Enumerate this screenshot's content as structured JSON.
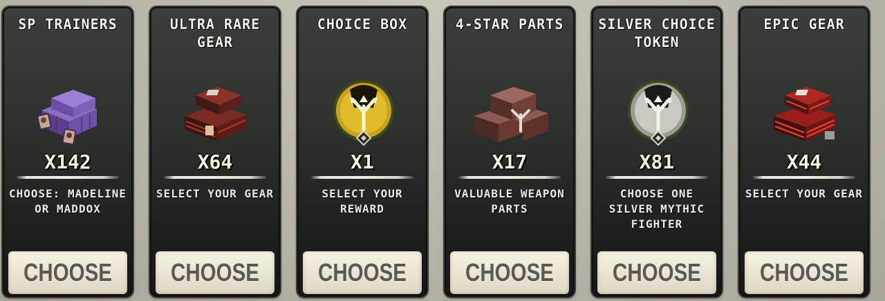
{
  "offers": [
    {
      "title": "SP TRAINERS",
      "art": "purple-crates-icon",
      "quantity": "X142",
      "description": "CHOOSE: MADELINE OR MADDOX",
      "button_label": "CHOOSE"
    },
    {
      "title": "ULTRA RARE GEAR",
      "art": "red-gear-crates-icon",
      "quantity": "X64",
      "description": "SELECT YOUR GEAR",
      "button_label": "CHOOSE"
    },
    {
      "title": "CHOICE BOX",
      "art": "gold-choice-token-icon",
      "quantity": "X1",
      "description": "SELECT YOUR REWARD",
      "button_label": "CHOOSE"
    },
    {
      "title": "4-STAR PARTS",
      "art": "weapon-parts-crates-icon",
      "quantity": "X17",
      "description": "VALUABLE WEAPON PARTS",
      "button_label": "CHOOSE"
    },
    {
      "title": "SILVER CHOICE TOKEN",
      "art": "silver-choice-token-icon",
      "quantity": "X81",
      "description": "CHOOSE ONE SILVER MYTHIC FIGHTER",
      "button_label": "CHOOSE"
    },
    {
      "title": "EPIC GEAR",
      "art": "red-epic-crates-icon",
      "quantity": "X44",
      "description": "SELECT YOUR GEAR",
      "button_label": "CHOOSE"
    }
  ],
  "colors": {
    "card_bg": "#2f312f",
    "title_text": "#f4f2ec",
    "quantity_text": "#f8f3d8",
    "button_bg": "#ece7d4",
    "button_text": "#5a5954"
  }
}
